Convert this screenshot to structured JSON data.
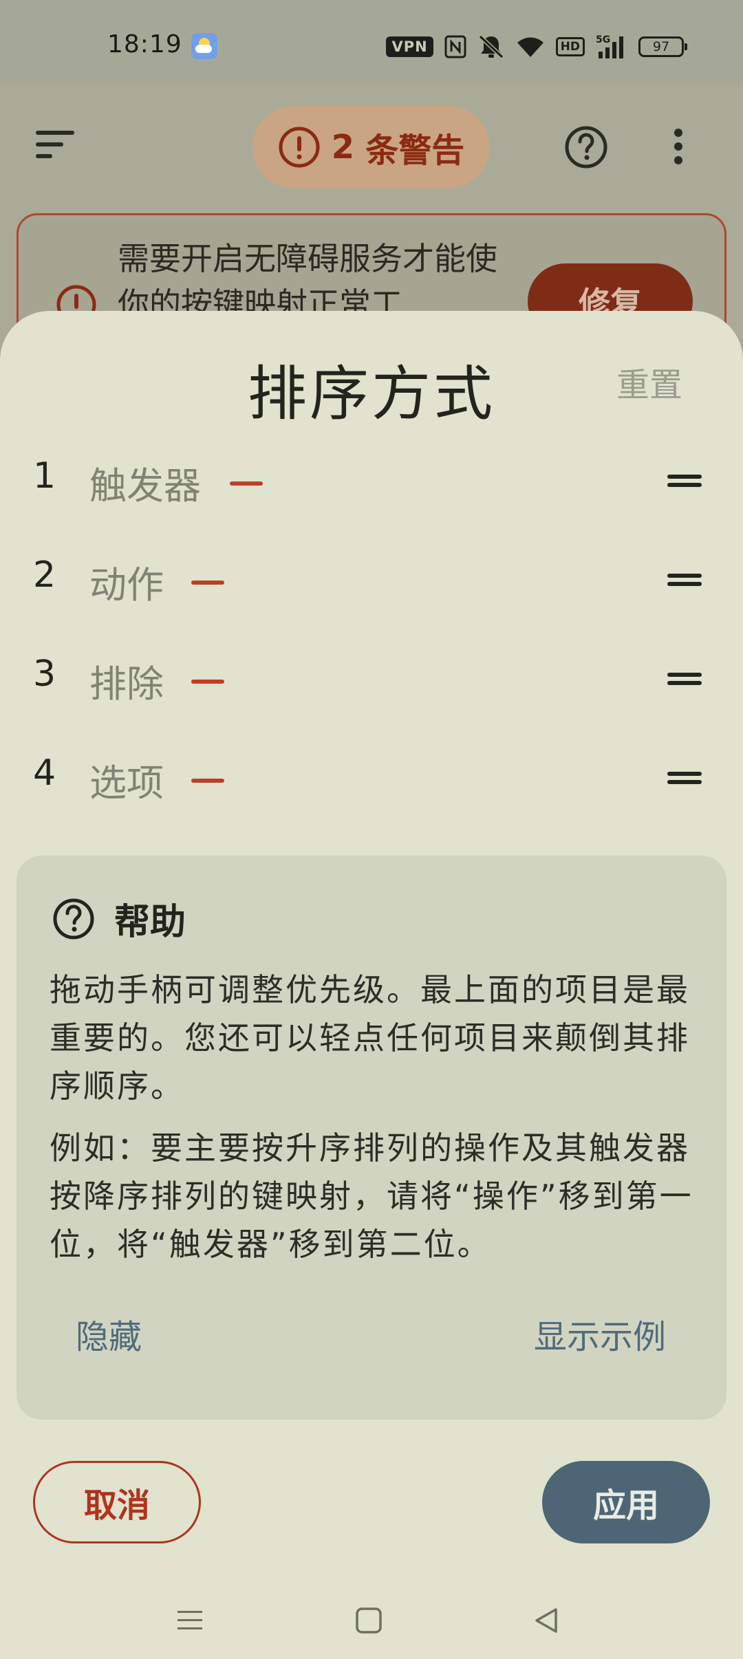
{
  "status_bar": {
    "time": "18:19",
    "vpn": "VPN",
    "hd": "HD",
    "network": "5G",
    "battery": "97",
    "icons": [
      "weather-icon",
      "nfc-icon",
      "mute-icon",
      "wifi-icon",
      "signal-icon",
      "battery-icon"
    ]
  },
  "app_bar": {
    "warnings_count": "2",
    "warnings_label": "条警告",
    "icons": [
      "menu-icon",
      "alert-icon",
      "help-icon",
      "more-icon"
    ]
  },
  "warning_card": {
    "text": "需要开启无障碍服务才能使你的按键映射正常工",
    "fix_label": "修复"
  },
  "sheet": {
    "title": "排序方式",
    "reset_label": "重置",
    "items": [
      {
        "num": "1",
        "label": "触发器"
      },
      {
        "num": "2",
        "label": "动作"
      },
      {
        "num": "3",
        "label": "排除"
      },
      {
        "num": "4",
        "label": "选项"
      }
    ],
    "help": {
      "title": "帮助",
      "paragraph1": "拖动手柄可调整优先级。最上面的项目是最重要的。您还可以轻点任何项目来颠倒其排序顺序。",
      "paragraph2": "例如：要主要按升序排列的操作及其触发器按降序排列的键映射，请将“操作”移到第一位，将“触发器”移到第二位。",
      "hide_label": "隐藏",
      "show_example_label": "显示示例"
    },
    "cancel_label": "取消",
    "apply_label": "应用"
  },
  "colors": {
    "accent_red": "#b0331d",
    "primary_blue": "#4d6676",
    "sheet_bg": "#e1e3cf"
  }
}
